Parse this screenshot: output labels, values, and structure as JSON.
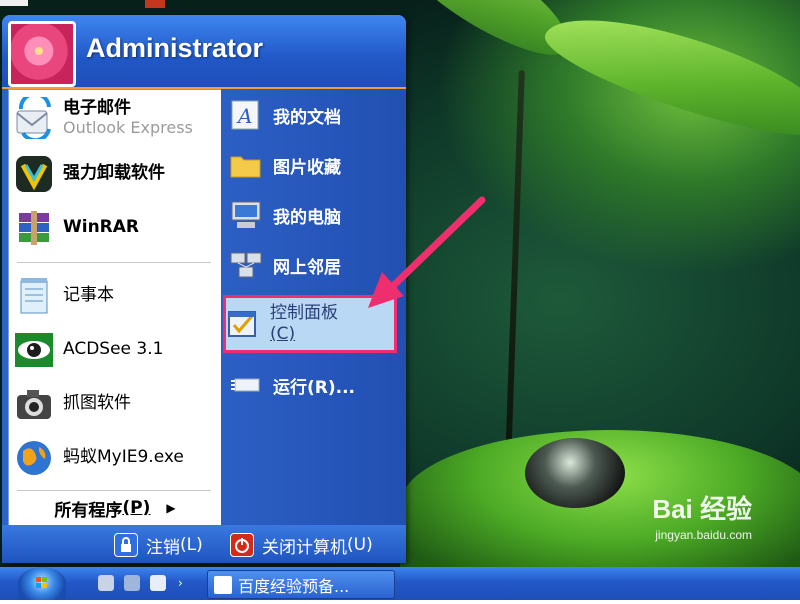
{
  "user": {
    "name": "Administrator"
  },
  "pinned": [
    {
      "label": "电子邮件",
      "sub": "Outlook Express",
      "icon": "outlook-express-icon"
    },
    {
      "label": "强力卸载软件",
      "icon": "uninstaller-icon"
    },
    {
      "label": "WinRAR",
      "icon": "winrar-icon"
    }
  ],
  "recent": [
    {
      "label": "记事本",
      "icon": "notepad-icon"
    },
    {
      "label": "ACDSee 3.1",
      "icon": "acdsee-icon"
    },
    {
      "label": "抓图软件",
      "icon": "camera-icon"
    },
    {
      "label": "蚂蚁MyIE9.exe",
      "icon": "globe-icon"
    }
  ],
  "all_programs": {
    "label": "所有程序",
    "hotkey": "(P)"
  },
  "right_items": [
    {
      "label": "我的文档",
      "icon": "my-documents-icon"
    },
    {
      "label": "图片收藏",
      "icon": "folder-icon"
    },
    {
      "label": "我的电脑",
      "icon": "my-computer-icon"
    },
    {
      "label": "网上邻居",
      "icon": "network-icon"
    },
    {
      "label": "控制面板",
      "hotkey": "(C)",
      "icon": "control-panel-icon",
      "highlighted": true
    },
    {
      "label": "运行",
      "hotkey": "(R)...",
      "icon": "run-icon"
    }
  ],
  "footer": {
    "logoff": {
      "label": "注销",
      "hotkey": "(L)"
    },
    "shutdown": {
      "label": "关闭计算机",
      "hotkey": "(U)"
    }
  },
  "taskbar": {
    "task": "百度经验预备..."
  },
  "watermark": {
    "brand": "Bai 经验",
    "url": "jingyan.baidu.com"
  },
  "colors": {
    "highlight_border": "#ee2e6e",
    "menu_blue": "#2b63c8",
    "header_accent": "#f39a3a"
  }
}
